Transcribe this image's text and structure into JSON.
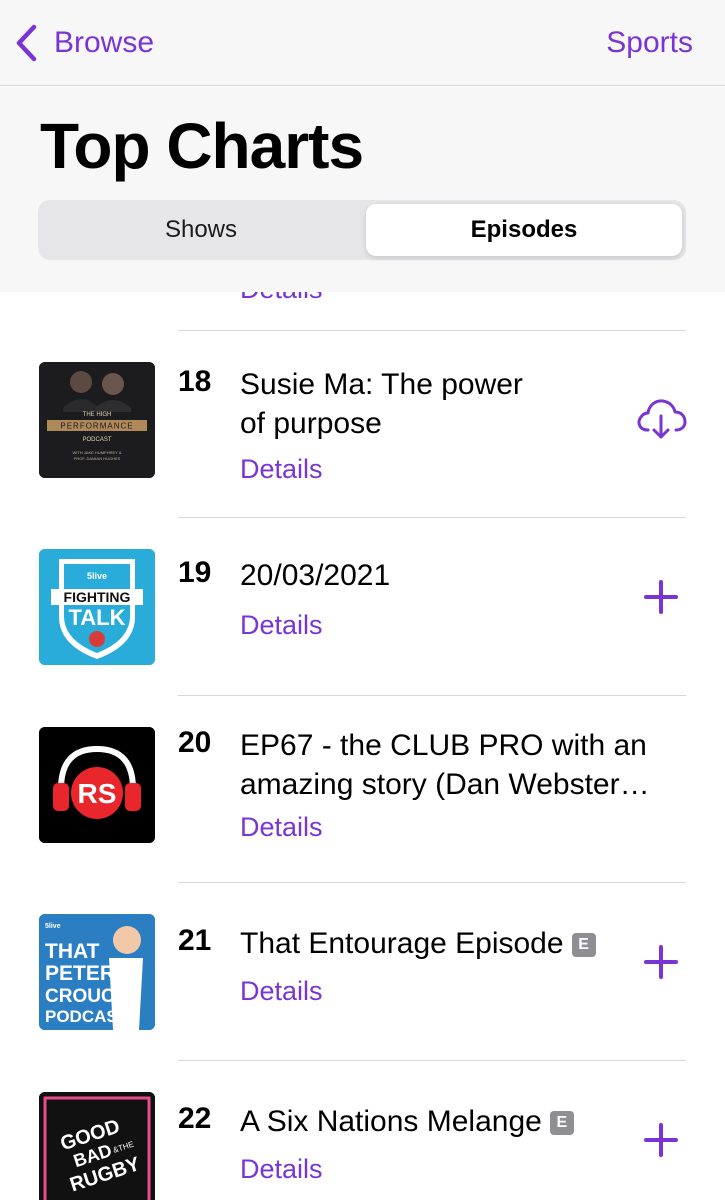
{
  "nav": {
    "back_label": "Browse",
    "right_label": "Sports",
    "accent": "#7a34d6"
  },
  "header": {
    "title": "Top Charts",
    "segments": {
      "shows": "Shows",
      "episodes": "Episodes",
      "selected": "Episodes"
    }
  },
  "details_label": "Details",
  "episodes": [
    {
      "rank": "18",
      "title_line1": "Susie Ma: The power",
      "title_line2": "of purpose",
      "details": "Details",
      "action": "download-cloud-icon",
      "artwork_text": [
        "THE HIGH",
        "PERFORMANCE",
        "PODCAST",
        "WITH JAKE HUMPHREY &",
        "PROF. DAMIAN HUGHES"
      ]
    },
    {
      "rank": "19",
      "title_line1": "20/03/2021",
      "details": "Details",
      "action": "plus-icon",
      "artwork_text": [
        "FIGHTING",
        "TALK",
        "5live"
      ]
    },
    {
      "rank": "20",
      "title_line1": "EP67 - the CLUB PRO with an",
      "title_line2": "amazing story (Dan Webster…",
      "details": "Details",
      "action": "plus-icon",
      "artwork_text": [
        "RS"
      ]
    },
    {
      "rank": "21",
      "title_line1": "That Entourage Episode",
      "explicit": "E",
      "details": "Details",
      "action": "plus-icon",
      "artwork_text": [
        "THAT",
        "PETER",
        "CROUCH",
        "PODCAST",
        "5live"
      ]
    },
    {
      "rank": "22",
      "title_line1": "A Six Nations Melange",
      "explicit": "E",
      "details": "Details",
      "action": "plus-icon",
      "artwork_text": [
        "GOOD",
        "BAD",
        "&THE",
        "RUGBY"
      ]
    }
  ]
}
